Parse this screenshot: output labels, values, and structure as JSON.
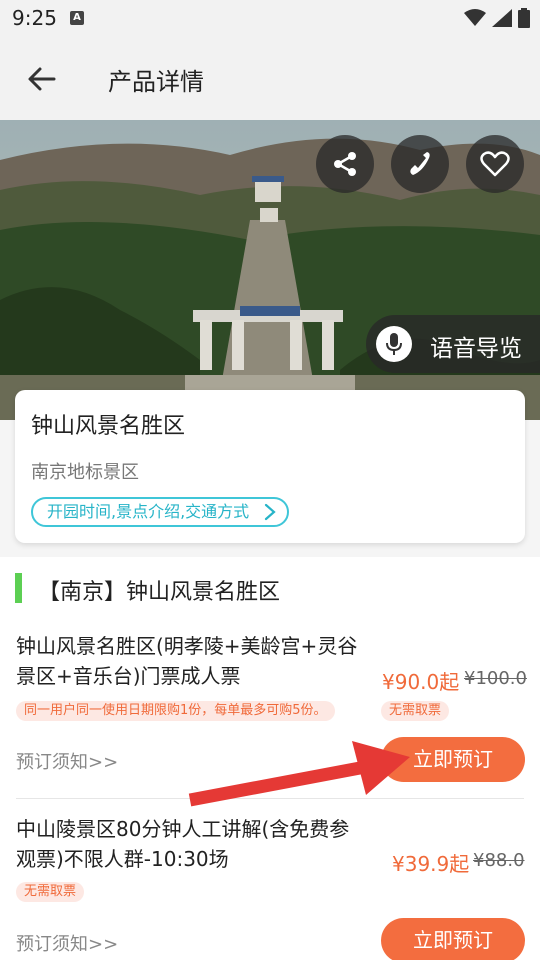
{
  "status_bar": {
    "time": "9:25",
    "notification_icon": "A"
  },
  "app_bar": {
    "title": "产品详情"
  },
  "hero": {
    "buttons": [
      "share-icon",
      "phone-icon",
      "heart-icon"
    ],
    "voice_guide_label": "语音导览"
  },
  "info_card": {
    "name": "钟山风景名胜区",
    "subtitle": "南京地标景区",
    "links_label": "开园时间,景点介绍,交通方式"
  },
  "section": {
    "title": "【南京】钟山风景名胜区"
  },
  "products": [
    {
      "title_line1": "钟山风景名胜区(明孝陵+美龄宫+灵谷",
      "title_line2": "景区+音乐台)门票成人票",
      "price": "¥90.0起",
      "original_price": "¥100.0",
      "tags": [
        "同一用户同一使用日期限购1份，每单最多可购5份。",
        "无需取票"
      ],
      "notice": "预订须知>>",
      "book_label": "立即预订"
    },
    {
      "title_line1": "中山陵景区80分钟人工讲解(含免费参",
      "title_line2": "观票)不限人群-10:30场",
      "price": "¥39.9起",
      "original_price": "¥88.0",
      "tags": [
        "无需取票"
      ],
      "notice": "预订须知>>",
      "book_label": "立即预订"
    }
  ],
  "colors": {
    "accent": "#f36d3f",
    "price": "#f06a3a",
    "cyan": "#3fc6d8",
    "green_bar": "#5ccf53",
    "annotation_arrow": "#e53935"
  }
}
